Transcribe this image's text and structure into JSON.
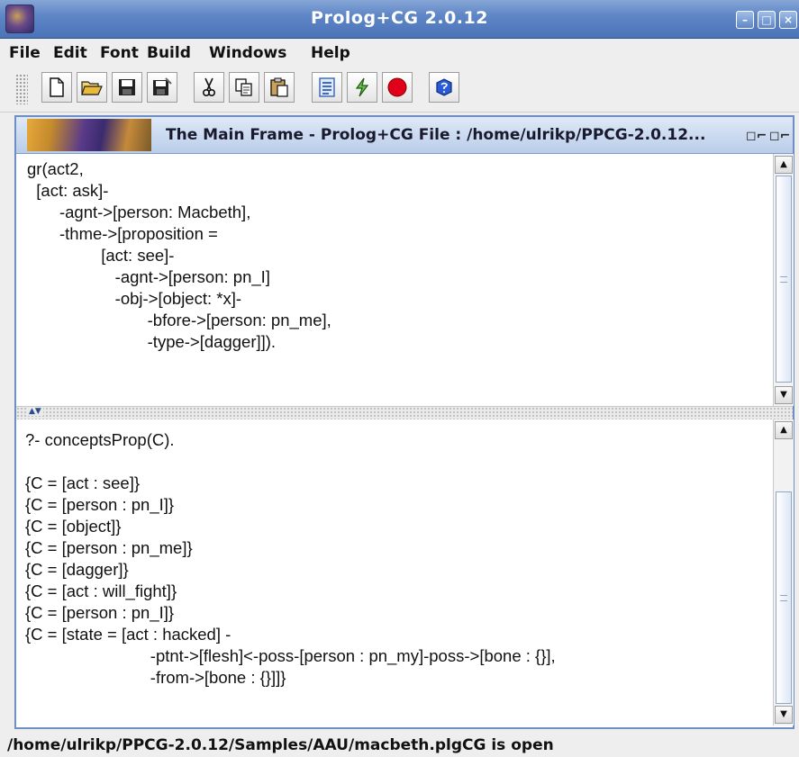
{
  "window": {
    "title": "Prolog+CG 2.0.12"
  },
  "menu": [
    "File",
    "Edit",
    "Font",
    "Build",
    "Windows",
    "Help"
  ],
  "toolbar": {
    "buttons": [
      "new-file-icon",
      "open-folder-icon",
      "save-icon",
      "save-all-icon",
      "cut-icon",
      "copy-icon",
      "paste-icon",
      "list-icon",
      "run-icon",
      "stop-icon",
      "help-icon"
    ]
  },
  "frame": {
    "title": "The Main Frame - Prolog+CG File : /home/ulrikp/PPCG-2.0.12...",
    "program_lines": [
      "gr(act2,",
      "  [act: ask]-",
      "       -agnt->[person: Macbeth],",
      "       -thme->[proposition =",
      "                [act: see]-",
      "                   -agnt->[person: pn_I]",
      "                   -obj->[object: *x]-",
      "                          -bfore->[person: pn_me],",
      "                          -type->[dagger]])."
    ],
    "output_lines": [
      "?- conceptsProp(C).",
      "",
      "{C = [act : see]}",
      "{C = [person : pn_I]}",
      "{C = [object]}",
      "{C = [person : pn_me]}",
      "{C = [dagger]}",
      "{C = [act : will_fight]}",
      "{C = [person : pn_I]}",
      "{C = [state = [act : hacked] -",
      "                           -ptnt->[flesh]<-poss-[person : pn_my]-poss->[bone : {}],",
      "                           -from->[bone : {}]]}"
    ]
  },
  "status": "/home/ulrikp/PPCG-2.0.12/Samples/AAU/macbeth.plgCG is open"
}
